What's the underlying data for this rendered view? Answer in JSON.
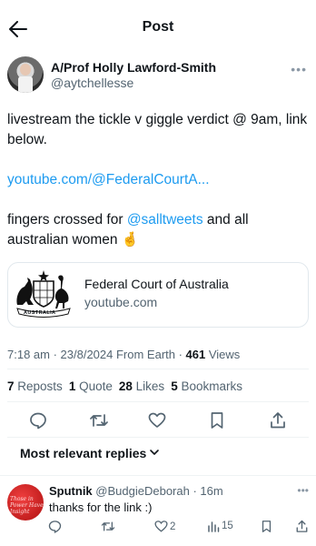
{
  "header": {
    "title": "Post"
  },
  "author": {
    "name": "A/Prof Holly Lawford-Smith",
    "handle": "@aytchellesse"
  },
  "post": {
    "line1": "livestream the tickle v giggle verdict @ 9am, link below.",
    "link": "youtube.com/@FederalCourtA...",
    "line3_prefix": "fingers crossed for ",
    "mention": "@salltweets",
    "line3_suffix": " and all australian women",
    "emoji": "🤞"
  },
  "card": {
    "title": "Federal Court of Australia",
    "domain": "youtube.com",
    "logo_text": "AUSTRALIA"
  },
  "meta": {
    "timestamp": "7:18 am · 23/8/2024 From Earth · ",
    "views_count": "461",
    "views_label": " Views"
  },
  "stats": {
    "reposts_count": "7",
    "reposts_label": "Reposts",
    "quotes_count": "1",
    "quotes_label": "Quote",
    "likes_count": "28",
    "likes_label": "Likes",
    "bookmarks_count": "5",
    "bookmarks_label": "Bookmarks"
  },
  "replies_sort": {
    "label": "Most relevant replies"
  },
  "reply": {
    "name": "Sputnik",
    "handle": "@BudgieDeborah",
    "sep": " · ",
    "time": "16m",
    "text": "thanks for the link :)",
    "likes": "2",
    "views": "15",
    "avatar_text": "Those in Power Have Insight"
  },
  "colors": {
    "link": "#1d9bf0",
    "secondary_text": "#536471",
    "primary_text": "#0f1419"
  }
}
